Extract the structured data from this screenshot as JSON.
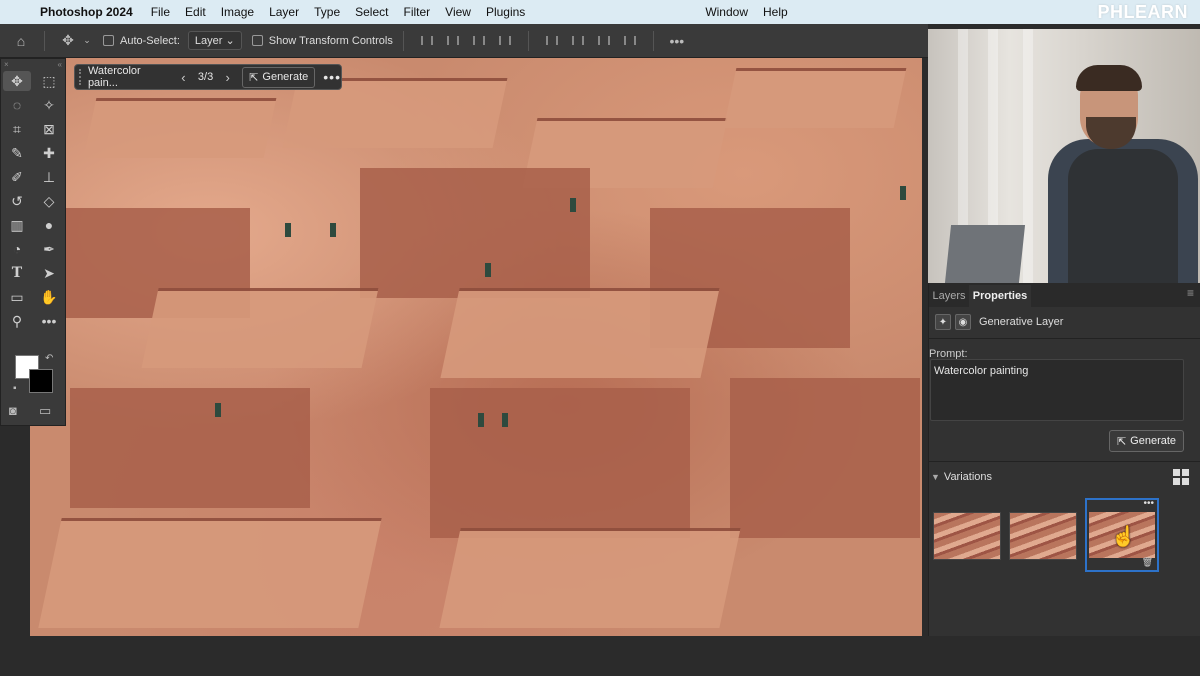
{
  "menubar": {
    "app_name": "Photoshop 2024",
    "items": [
      "File",
      "Edit",
      "Image",
      "Layer",
      "Type",
      "Select",
      "Filter",
      "View",
      "Plugins"
    ],
    "right_items": [
      "Window",
      "Help"
    ],
    "brand": "PHLEARN"
  },
  "options": {
    "auto_select_label": "Auto-Select:",
    "auto_select_value": "Layer",
    "transform_label": "Show Transform Controls"
  },
  "contextual": {
    "layer_name": "Watercolor pain...",
    "count": "3/3",
    "generate_label": "Generate"
  },
  "panel": {
    "tabs": [
      "Layers",
      "Properties"
    ],
    "active_tab": "Properties",
    "layer_type": "Generative Layer",
    "prompt_label": "Prompt:",
    "prompt_value": "Watercolor painting",
    "generate_label": "Generate",
    "variations_label": "Variations"
  },
  "icons": {
    "move": "move-icon",
    "home": "home-icon"
  },
  "colors": {
    "accent": "#2d72c9",
    "menubar": "#dcebf3"
  }
}
